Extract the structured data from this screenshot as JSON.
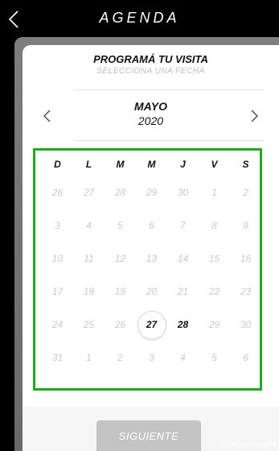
{
  "header": {
    "title": "AGENDA"
  },
  "card": {
    "title": "PROGRAMÁ TU VISITA",
    "subtitle": "SELECCIONA UNA FECHA"
  },
  "calendar": {
    "month": "MAYO",
    "year": "2020",
    "weekdays": [
      "D",
      "L",
      "M",
      "M",
      "J",
      "V",
      "S"
    ],
    "weeks": [
      [
        "26",
        "27",
        "28",
        "29",
        "30",
        "1",
        "2"
      ],
      [
        "3",
        "4",
        "5",
        "6",
        "7",
        "8",
        "9"
      ],
      [
        "10",
        "11",
        "12",
        "13",
        "14",
        "15",
        "16"
      ],
      [
        "17",
        "18",
        "19",
        "20",
        "21",
        "22",
        "23"
      ],
      [
        "24",
        "25",
        "26",
        "27",
        "28",
        "29",
        "30"
      ],
      [
        "31",
        "1",
        "2",
        "3",
        "4",
        "5",
        "6"
      ]
    ],
    "selected_day": "27",
    "available_days": [
      "27",
      "28"
    ],
    "highlight_color": "#1faa1f"
  },
  "footer": {
    "next_label": "SIGUIENTE"
  },
  "watermark": "@jalStereesKk"
}
